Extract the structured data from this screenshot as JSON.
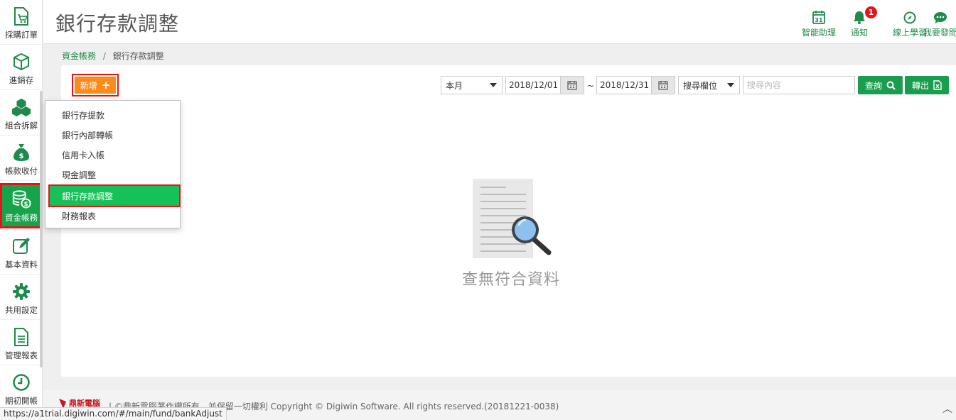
{
  "sidebar": {
    "items": [
      {
        "label": "採購訂單",
        "icon": "purchase-order-icon"
      },
      {
        "label": "進銷存",
        "icon": "box-icon"
      },
      {
        "label": "組合拆解",
        "icon": "boxes-icon"
      },
      {
        "label": "帳款收付",
        "icon": "money-bag-icon"
      },
      {
        "label": "資金帳務",
        "icon": "coins-database-icon"
      },
      {
        "label": "基本資料",
        "icon": "edit-icon"
      },
      {
        "label": "共用設定",
        "icon": "gear-icon"
      },
      {
        "label": "管理報表",
        "icon": "report-icon"
      },
      {
        "label": "期初開帳",
        "icon": "clock-icon"
      }
    ],
    "active_index": 4
  },
  "header": {
    "title": "銀行存款調整",
    "buttons": [
      {
        "label": "智能助理",
        "icon": "calendar-icon"
      },
      {
        "label": "通知",
        "icon": "bell-icon",
        "badge": "1"
      },
      {
        "label": "線上學習",
        "icon": "compass-icon"
      },
      {
        "label": "我要發問",
        "icon": "chat-icon"
      }
    ]
  },
  "breadcrumb": {
    "parent": "資金帳務",
    "separator": "/",
    "current": "銀行存款調整"
  },
  "toolbar": {
    "add_label": "新增",
    "period_select": "本月",
    "date_from": "2018/12/01",
    "date_sep": "~",
    "date_to": "2018/12/31",
    "field_select": "搜尋欄位",
    "search_placeholder": "搜尋內容",
    "query_label": "查詢",
    "export_label": "轉出"
  },
  "dropdown": {
    "items": [
      "銀行存提款",
      "銀行內部轉帳",
      "信用卡入帳",
      "現金調整",
      "銀行存款調整",
      "財務報表"
    ],
    "active_index": 4
  },
  "empty_state": {
    "text": "查無符合資料"
  },
  "footer": {
    "logo_text": "鼎新電腦",
    "copyright": "| ©鼎新電腦著作權所有，並保留一切權利 Copyright © Digiwin Software. All rights reserved.(20181221-0038)",
    "status_url": "https://a1trial.digiwin.com/#/main/fund/bankAdjust"
  },
  "colors": {
    "brand_green": "#1a9d4f",
    "active_green": "#17c15a",
    "highlight_red": "#e4141b",
    "add_orange": "#f98c1b"
  }
}
